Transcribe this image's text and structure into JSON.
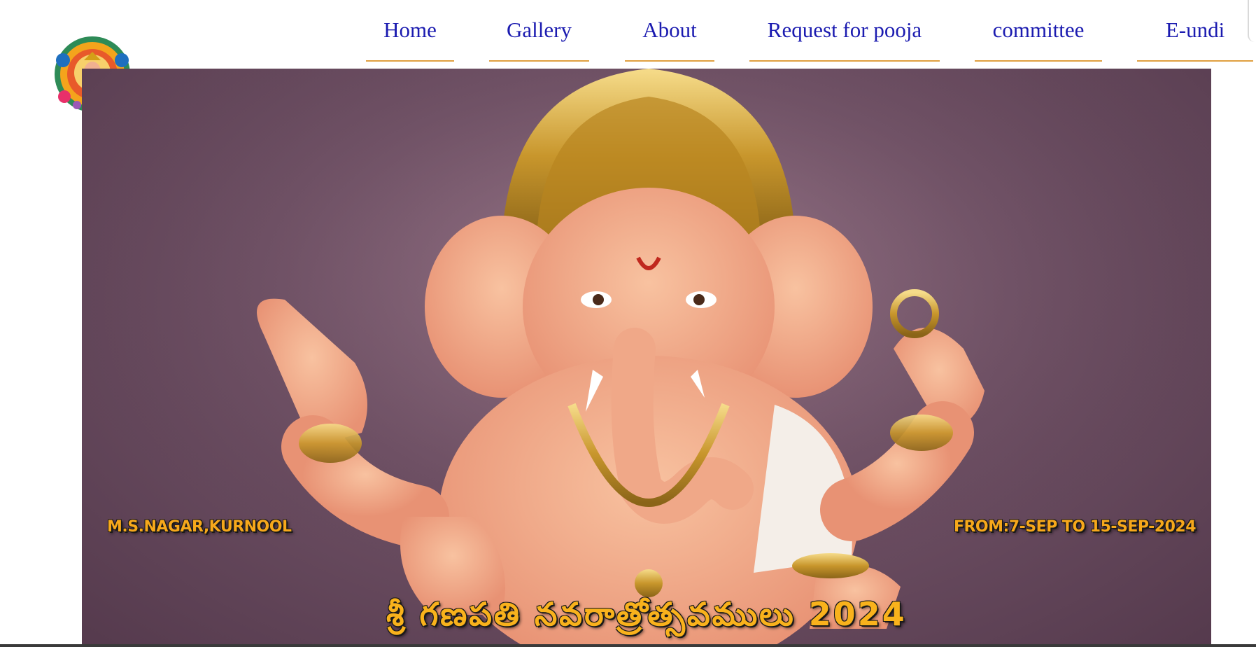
{
  "nav": {
    "items": [
      {
        "label": "Home"
      },
      {
        "label": "Gallery"
      },
      {
        "label": "About"
      },
      {
        "label": "Request for pooja"
      },
      {
        "label": "committee"
      },
      {
        "label": "E-undi"
      }
    ]
  },
  "logo": {
    "icon": "ganesha-logo-icon"
  },
  "hero": {
    "location": "M.S.NAGAR,KURNOOL",
    "dates": "FROM:7-SEP TO 15-SEP-2024",
    "festival_title": "శ్రీ గణపతి నవరాత్రోత్సవములు 2024",
    "image": "ganesha-idol-image"
  },
  "colors": {
    "nav_text": "#1b1bb0",
    "nav_underline": "#e0a040",
    "overlay_text": "#f7a81b",
    "hero_background": "#6e5064"
  }
}
